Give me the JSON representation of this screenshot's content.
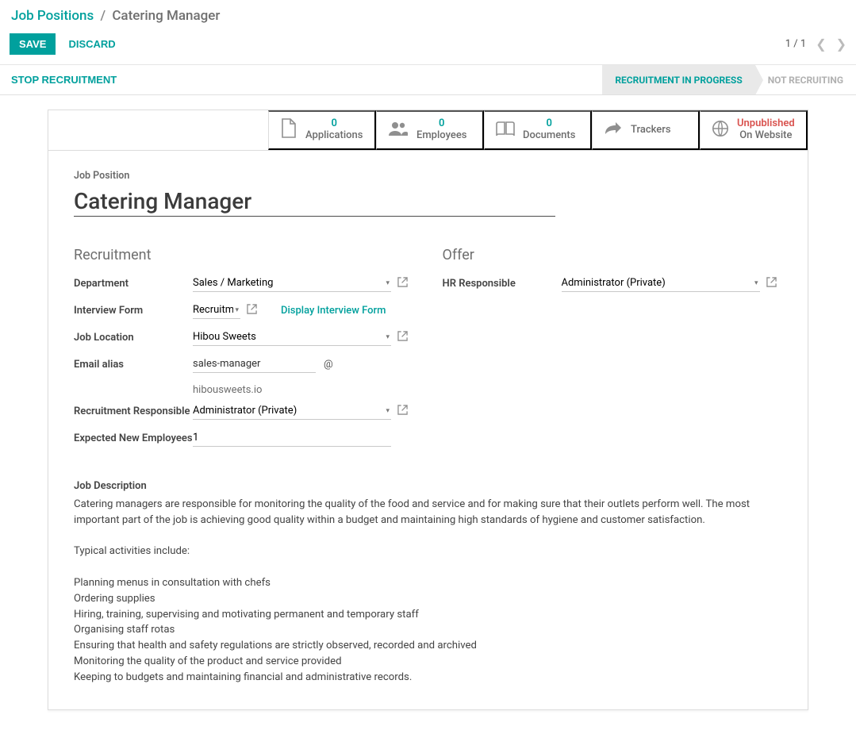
{
  "breadcrumbs": {
    "root": "Job Positions",
    "current": "Catering Manager"
  },
  "actions": {
    "save": "SAVE",
    "discard": "DISCARD"
  },
  "pager": {
    "text": "1 / 1"
  },
  "state": {
    "stop": "STOP RECRUITMENT",
    "active": "RECRUITMENT IN PROGRESS",
    "inactive": "NOT RECRUITING"
  },
  "stats": {
    "applications": {
      "value": "0",
      "label": "Applications"
    },
    "employees": {
      "value": "0",
      "label": "Employees"
    },
    "documents": {
      "value": "0",
      "label": "Documents"
    },
    "trackers": {
      "label": "Trackers"
    },
    "website": {
      "line1": "Unpublished",
      "line2": "On Website"
    }
  },
  "form": {
    "title_label": "Job Position",
    "title_value": "Catering Manager",
    "sections": {
      "recruitment": "Recruitment",
      "offer": "Offer"
    },
    "labels": {
      "department": "Department",
      "interview_form": "Interview Form",
      "job_location": "Job Location",
      "email_alias": "Email alias",
      "recruitment_responsible": "Recruitment Responsible",
      "expected_new_employees": "Expected New Employees",
      "hr_responsible": "HR Responsible",
      "job_description": "Job Description"
    },
    "values": {
      "department": "Sales / Marketing",
      "interview_form": "Recruitm",
      "display_interview": "Display Interview Form",
      "job_location": "Hibou Sweets",
      "email_alias": "sales-manager",
      "email_at": "@",
      "email_domain": "hibousweets.io",
      "recruitment_responsible": "Administrator (Private)",
      "expected_new_employees": "1",
      "hr_responsible": "Administrator (Private)"
    },
    "description": "Catering managers are responsible for monitoring the quality of the food and service and for making sure that their outlets perform well. The most important part of the job is achieving good quality within a budget and maintaining high standards of hygiene and customer satisfaction.\n\nTypical activities include:\n\nPlanning menus in consultation with chefs\nOrdering supplies\nHiring, training, supervising and motivating permanent and temporary staff\nOrganising staff rotas\nEnsuring that health and safety regulations are strictly observed, recorded and archived\nMonitoring the quality of the product and service provided\nKeeping to budgets and maintaining financial and administrative records."
  }
}
